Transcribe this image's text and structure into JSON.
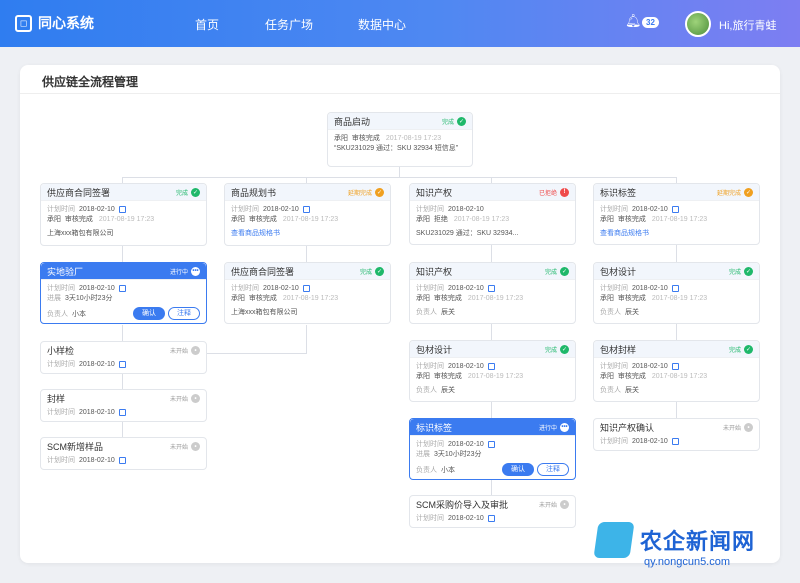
{
  "app": {
    "name": "同心系统"
  },
  "nav": [
    "首页",
    "任务广场",
    "数据中心"
  ],
  "header": {
    "notif_count": "32",
    "user": "Hi,旅行青蛙"
  },
  "panel": {
    "title": "供应链全流程管理"
  },
  "colors": {
    "primary": "#3b7bf0",
    "done": "#1fb86a",
    "late": "#f0a020",
    "rejected": "#ef4b4b"
  },
  "cards": {
    "root": {
      "title": "商品启动",
      "status": "完成",
      "r1": "承阳",
      "r1b": "审核完成",
      "r1t": "2017-08-19 17:23",
      "note": "“SKU231029 通过：SKU 32934 短信息”"
    },
    "c1a": {
      "title": "供应商合同签署",
      "status": "完成",
      "plan_k": "计划时间",
      "plan_v": "2018-02-10",
      "r1": "承阳",
      "r1b": "审核完成",
      "r1t": "2017-08-19 17:23",
      "note": "上海xxx箱包有限公司"
    },
    "c1b": {
      "title": "实地验厂",
      "status": "进行中",
      "plan_k": "计划时间",
      "plan_v": "2018-02-10",
      "prog_k": "进展",
      "prog_v": "3天10小时23分",
      "owner_k": "负责人",
      "owner_v": "小本",
      "btn1": "确认",
      "btn2": "注释"
    },
    "c1c": {
      "title": "小样检",
      "status": "未开始",
      "plan_k": "计划时间",
      "plan_v": "2018-02-10"
    },
    "c1d": {
      "title": "封样",
      "status": "未开始",
      "plan_k": "计划时间",
      "plan_v": "2018-02-10"
    },
    "c1e": {
      "title": "SCM新增样品",
      "status": "未开始",
      "plan_k": "计划时间",
      "plan_v": "2018-02-10"
    },
    "c2a": {
      "title": "商品规划书",
      "status": "延期完成",
      "plan_k": "计划时间",
      "plan_v": "2018-02-10",
      "r1": "承阳",
      "r1b": "审核完成",
      "r1t": "2017-08-19 17:23",
      "link": "查看商品规格书"
    },
    "c2b": {
      "title": "供应商合同签署",
      "status": "完成",
      "plan_k": "计划时间",
      "plan_v": "2018-02-10",
      "r1": "承阳",
      "r1b": "审核完成",
      "r1t": "2017-08-19 17:23",
      "note": "上海xxx箱包有限公司"
    },
    "c3a": {
      "title": "知识产权",
      "status": "已拒绝",
      "plan_k": "计划时间",
      "plan_v": "2018-02-10",
      "r1": "承阳",
      "r1b": "拒绝",
      "r1t": "2017-08-19 17:23",
      "note": "SKU231029 通过：SKU 32934..."
    },
    "c3b": {
      "title": "知识产权",
      "status": "完成",
      "plan_k": "计划时间",
      "plan_v": "2018-02-10",
      "r1": "承阳",
      "r1b": "审核完成",
      "r1t": "2017-08-19 17:23",
      "owner_k": "负责人",
      "owner_v": "辰关"
    },
    "c3c": {
      "title": "包材设计",
      "status": "完成",
      "plan_k": "计划时间",
      "plan_v": "2018-02-10",
      "r1": "承阳",
      "r1b": "审核完成",
      "r1t": "2017-08-19 17:23",
      "owner_k": "负责人",
      "owner_v": "辰关"
    },
    "c3d": {
      "title": "标识标签",
      "status": "进行中",
      "plan_k": "计划时间",
      "plan_v": "2018-02-10",
      "prog_k": "进展",
      "prog_v": "3天10小时23分",
      "owner_k": "负责人",
      "owner_v": "小本",
      "btn1": "确认",
      "btn2": "注释"
    },
    "c3e": {
      "title": "SCM采购价导入及审批",
      "status": "未开始",
      "plan_k": "计划时间",
      "plan_v": "2018-02-10"
    },
    "c4a": {
      "title": "标识标签",
      "status": "延期完成",
      "plan_k": "计划时间",
      "plan_v": "2018-02-10",
      "r1": "承阳",
      "r1b": "审核完成",
      "r1t": "2017-08-19 17:23",
      "link": "查看商品规格书"
    },
    "c4b": {
      "title": "包材设计",
      "status": "完成",
      "plan_k": "计划时间",
      "plan_v": "2018-02-10",
      "r1": "承阳",
      "r1b": "审核完成",
      "r1t": "2017-08-19 17:23",
      "owner_k": "负责人",
      "owner_v": "辰关"
    },
    "c4c": {
      "title": "包材封样",
      "status": "完成",
      "plan_k": "计划时间",
      "plan_v": "2018-02-10",
      "r1": "承阳",
      "r1b": "审核完成",
      "r1t": "2017-08-19 17:23",
      "owner_k": "负责人",
      "owner_v": "辰关"
    },
    "c4d": {
      "title": "知识产权确认",
      "status": "未开始",
      "plan_k": "计划时间",
      "plan_v": "2018-02-10"
    }
  },
  "watermark": {
    "name": "农企新闻网",
    "url": "qy.nongcun5.com"
  }
}
